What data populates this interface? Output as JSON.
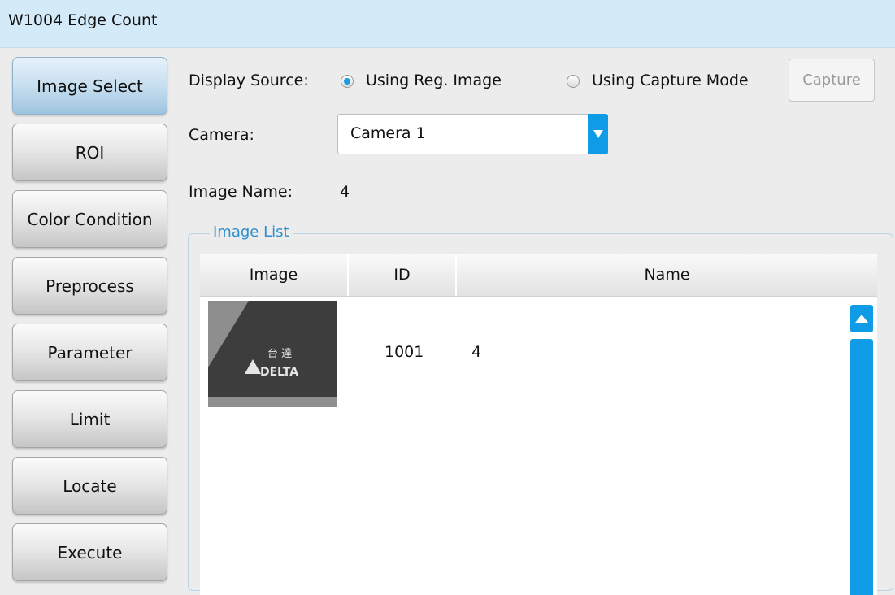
{
  "window": {
    "title": "W1004 Edge Count"
  },
  "nav": {
    "items": [
      {
        "label": "Image Select"
      },
      {
        "label": "ROI"
      },
      {
        "label": "Color Condition"
      },
      {
        "label": "Preprocess"
      },
      {
        "label": "Parameter"
      },
      {
        "label": "Limit"
      },
      {
        "label": "Locate"
      },
      {
        "label": "Execute"
      }
    ],
    "active_index": 0
  },
  "display_source": {
    "label": "Display Source:",
    "options": [
      {
        "label": "Using Reg. Image",
        "checked": true
      },
      {
        "label": "Using Capture Mode",
        "checked": false
      }
    ],
    "capture_label": "Capture"
  },
  "camera": {
    "label": "Camera:",
    "value": "Camera 1"
  },
  "image_name": {
    "label": "Image Name:",
    "value": "4"
  },
  "image_list": {
    "title": "Image List",
    "columns": [
      "Image",
      "ID",
      "Name"
    ],
    "rows": [
      {
        "id": "1001",
        "name": "4",
        "thumbnail": {
          "logo_chinese": "台 達",
          "logo_text": "DELTA"
        }
      }
    ]
  },
  "colors": {
    "accent": "#0f9be6",
    "titlebar": "#d4eaf8",
    "group_title": "#2d8fcf"
  }
}
